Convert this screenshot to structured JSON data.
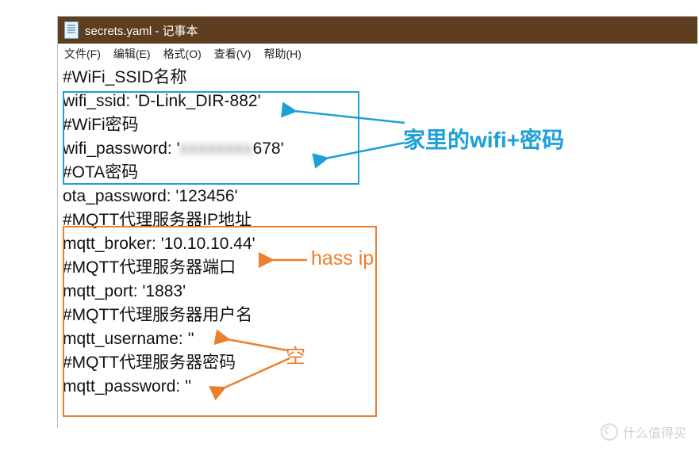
{
  "window": {
    "title": "secrets.yaml - 记事本"
  },
  "menu": {
    "file": "文件(F)",
    "edit": "编辑(E)",
    "format": "格式(O)",
    "view": "查看(V)",
    "help": "帮助(H)"
  },
  "lines": {
    "l1": "#WiFi_SSID名称",
    "l2": "wifi_ssid: 'D-Link_DIR-882'",
    "l3": "#WiFi密码",
    "l4a": "wifi_password: '",
    "l4b": "xxxxxxxx",
    "l4c": "678'",
    "l5": "#OTA密码",
    "l6": "ota_password: '123456'",
    "l7": "#MQTT代理服务器IP地址",
    "l8": "mqtt_broker: '10.10.10.44'",
    "l9": "#MQTT代理服务器端口",
    "l10": "mqtt_port: '1883'",
    "l11": "#MQTT代理服务器用户名",
    "l12": "mqtt_username: ''",
    "l13": "#MQTT代理服务器密码",
    "l14": "mqtt_password: ''"
  },
  "annotations": {
    "wifi": "家里的wifi+密码",
    "hass_ip": "hass ip",
    "empty": "空"
  },
  "watermark": "什么值得买",
  "colors": {
    "titlebar": "#5e3e1f",
    "blue": "#1ca0d8",
    "orange": "#ec7f2c"
  }
}
